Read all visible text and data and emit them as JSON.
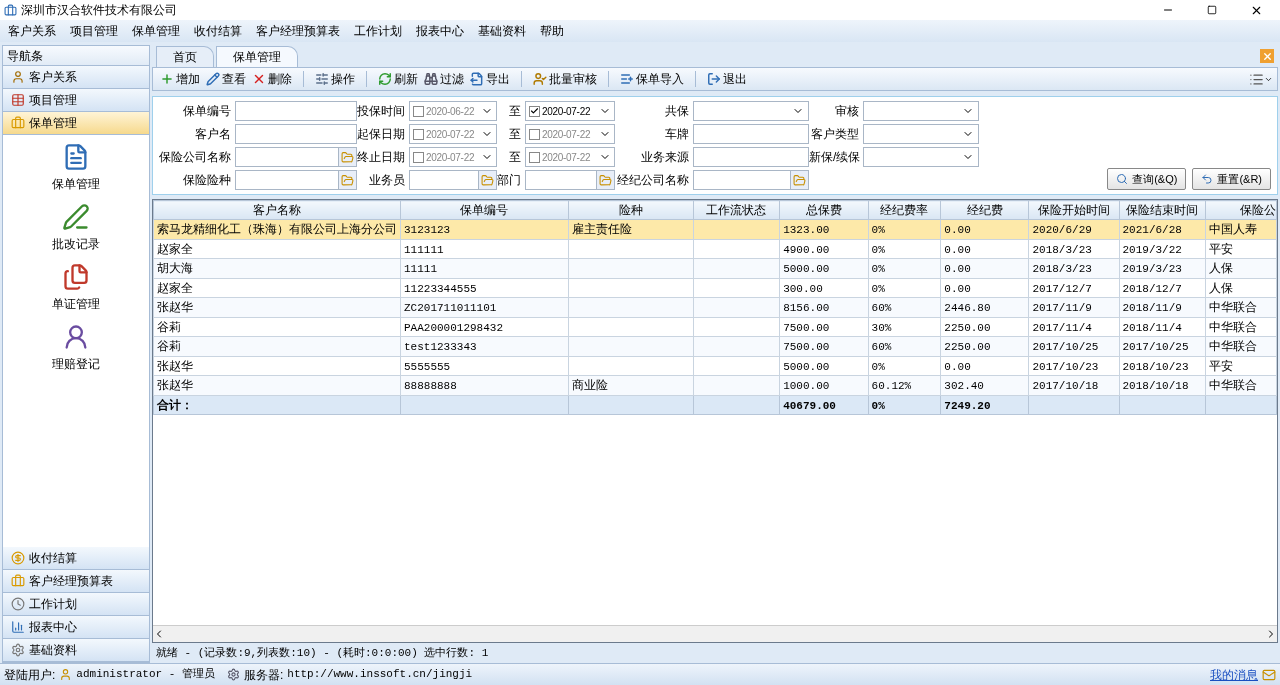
{
  "window": {
    "title": "深圳市汉合软件技术有限公司"
  },
  "menu": [
    "客户关系",
    "项目管理",
    "保单管理",
    "收付结算",
    "客户经理预算表",
    "工作计划",
    "报表中心",
    "基础资料",
    "帮助"
  ],
  "nav": {
    "title": "导航条",
    "items": [
      {
        "label": "客户关系",
        "expanded": false
      },
      {
        "label": "项目管理",
        "expanded": false
      },
      {
        "label": "保单管理",
        "expanded": true,
        "children": [
          "保单管理",
          "批改记录",
          "单证管理",
          "理赔登记"
        ]
      },
      {
        "label": "收付结算",
        "expanded": false
      },
      {
        "label": "客户经理预算表",
        "expanded": false
      },
      {
        "label": "工作计划",
        "expanded": false
      },
      {
        "label": "报表中心",
        "expanded": false
      },
      {
        "label": "基础资料",
        "expanded": false
      }
    ]
  },
  "tabs": [
    {
      "label": "首页",
      "selected": false
    },
    {
      "label": "保单管理",
      "selected": true
    }
  ],
  "toolbar": [
    [
      "增加",
      "查看",
      "删除"
    ],
    [
      "操作"
    ],
    [
      "刷新",
      "过滤",
      "导出"
    ],
    [
      "批量审核"
    ],
    [
      "保单导入"
    ],
    [
      "退出"
    ]
  ],
  "filters": [
    [
      {
        "kind": "label",
        "text": "保单编号"
      },
      {
        "kind": "text"
      },
      {
        "kind": "label",
        "text": "投保时间"
      },
      {
        "kind": "date",
        "checked": false,
        "value": "2020-06-22"
      },
      {
        "kind": "label",
        "text": "至"
      },
      {
        "kind": "date",
        "checked": true,
        "value": "2020-07-22"
      },
      {
        "kind": "label",
        "text": "共保"
      },
      {
        "kind": "combo"
      },
      {
        "kind": "label",
        "text": "审核"
      },
      {
        "kind": "combo"
      }
    ],
    [
      {
        "kind": "label",
        "text": "客户名"
      },
      {
        "kind": "text"
      },
      {
        "kind": "label",
        "text": "起保日期"
      },
      {
        "kind": "date",
        "checked": false,
        "value": "2020-07-22"
      },
      {
        "kind": "label",
        "text": "至"
      },
      {
        "kind": "date",
        "checked": false,
        "value": "2020-07-22"
      },
      {
        "kind": "label",
        "text": "车牌"
      },
      {
        "kind": "shaded"
      },
      {
        "kind": "label",
        "text": "客户类型"
      },
      {
        "kind": "combo"
      }
    ],
    [
      {
        "kind": "label",
        "text": "保险公司名称"
      },
      {
        "kind": "picker"
      },
      {
        "kind": "label",
        "text": "终止日期"
      },
      {
        "kind": "date",
        "checked": false,
        "value": "2020-07-22"
      },
      {
        "kind": "label",
        "text": "至"
      },
      {
        "kind": "date",
        "checked": false,
        "value": "2020-07-22"
      },
      {
        "kind": "label",
        "text": "业务来源"
      },
      {
        "kind": "text"
      },
      {
        "kind": "label",
        "text": "新保/续保"
      },
      {
        "kind": "combo"
      }
    ],
    [
      {
        "kind": "label",
        "text": "保险险种"
      },
      {
        "kind": "picker"
      },
      {
        "kind": "label",
        "text": "业务员"
      },
      {
        "kind": "picker"
      },
      {
        "kind": "label",
        "text": "部门"
      },
      {
        "kind": "picker"
      },
      {
        "kind": "label",
        "text": "经纪公司名称"
      },
      {
        "kind": "picker"
      }
    ]
  ],
  "buttons": [
    "查询(&Q)",
    "重置(&R)"
  ],
  "table": {
    "columns": [
      "客户名称",
      "保单编号",
      "险种",
      "工作流状态",
      "总保费",
      "经纪费率",
      "经纪费",
      "保险开始时间",
      "保险结束时间",
      "保险公"
    ],
    "rows": [
      {
        "selected": true,
        "cells": [
          "索马龙精细化工（珠海）有限公司上海分公司",
          "3123123",
          "雇主责任险",
          null,
          "1323.00",
          "0%",
          "0.00",
          "2020/6/29",
          "2021/6/28",
          "中国人寿"
        ]
      },
      {
        "selected": false,
        "cells": [
          "赵家全",
          "111111",
          null,
          null,
          "4900.00",
          "0%",
          "0.00",
          "2018/3/23",
          "2019/3/22",
          "平安"
        ]
      },
      {
        "selected": false,
        "cells": [
          "胡大海",
          "11111",
          null,
          null,
          "5000.00",
          "0%",
          "0.00",
          "2018/3/23",
          "2019/3/23",
          "人保"
        ]
      },
      {
        "selected": false,
        "cells": [
          "赵家全",
          "11223344555",
          null,
          null,
          "300.00",
          "0%",
          "0.00",
          "2017/12/7",
          "2018/12/7",
          "人保"
        ]
      },
      {
        "selected": false,
        "cells": [
          "张赵华",
          "ZC201711011101",
          null,
          null,
          "8156.00",
          "60%",
          "2446.80",
          "2017/11/9",
          "2018/11/9",
          "中华联合"
        ]
      },
      {
        "selected": false,
        "cells": [
          "谷莉",
          "PAA200001298432",
          null,
          null,
          "7500.00",
          "30%",
          "2250.00",
          "2017/11/4",
          "2018/11/4",
          "中华联合"
        ]
      },
      {
        "selected": false,
        "cells": [
          "谷莉",
          "test1233343",
          null,
          null,
          "7500.00",
          "60%",
          "2250.00",
          "2017/10/25",
          "2017/10/25",
          "中华联合"
        ]
      },
      {
        "selected": false,
        "cells": [
          "张赵华",
          "5555555",
          null,
          null,
          "5000.00",
          "0%",
          "0.00",
          "2017/10/23",
          "2018/10/23",
          "平安"
        ]
      },
      {
        "selected": false,
        "cells": [
          "张赵华",
          "88888888",
          "商业险",
          null,
          "1000.00",
          "60.12%",
          "302.40",
          "2017/10/18",
          "2018/10/18",
          "中华联合"
        ]
      }
    ],
    "total": {
      "label": "合计：",
      "premium": "40679.00",
      "rate": "0%",
      "fee": "7249.20"
    }
  },
  "status": "就绪 - (记录数:9,列表数:10) - (耗时:0:0:00) 选中行数: 1",
  "footer": {
    "user_label": "登陆用户:",
    "user": "administrator - 管理员",
    "server_label": "服务器:",
    "server": "http://www.inssoft.cn/jingji",
    "messages": "我的消息"
  }
}
